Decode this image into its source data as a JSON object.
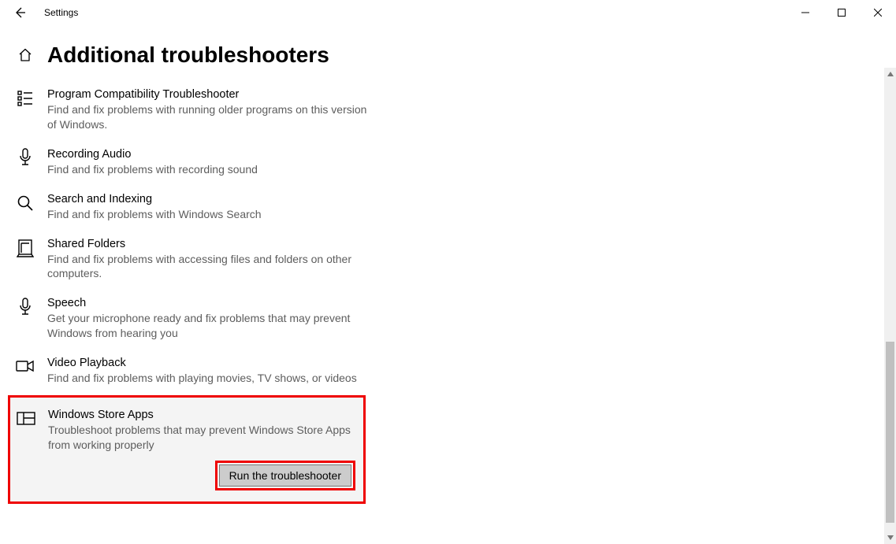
{
  "window": {
    "title": "Settings"
  },
  "page": {
    "heading": "Additional troubleshooters"
  },
  "troubleshooters": [
    {
      "name": "Program Compatibility Troubleshooter",
      "desc": "Find and fix problems with running older programs on this version of Windows.",
      "icon": "compat"
    },
    {
      "name": "Recording Audio",
      "desc": "Find and fix problems with recording sound",
      "icon": "mic"
    },
    {
      "name": "Search and Indexing",
      "desc": "Find and fix problems with Windows Search",
      "icon": "search"
    },
    {
      "name": "Shared Folders",
      "desc": "Find and fix problems with accessing files and folders on other computers.",
      "icon": "shared"
    },
    {
      "name": "Speech",
      "desc": "Get your microphone ready and fix problems that may prevent Windows from hearing you",
      "icon": "mic"
    },
    {
      "name": "Video Playback",
      "desc": "Find and fix problems with playing movies, TV shows, or videos",
      "icon": "video"
    },
    {
      "name": "Windows Store Apps",
      "desc": "Troubleshoot problems that may prevent Windows Store Apps from working properly",
      "icon": "store"
    }
  ],
  "selected": {
    "button_label": "Run the troubleshooter"
  }
}
